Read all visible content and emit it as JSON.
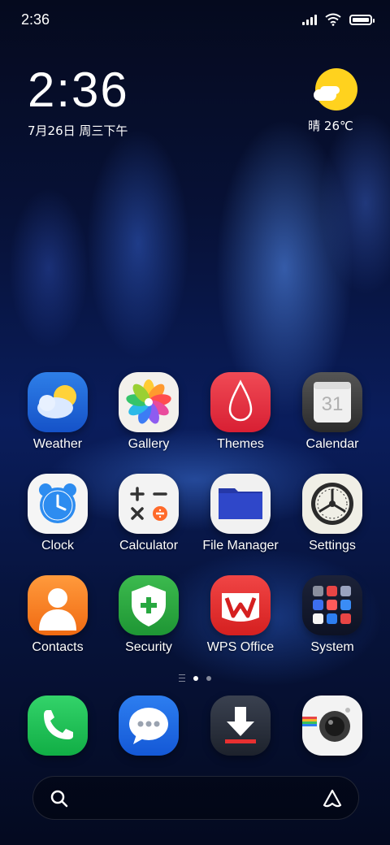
{
  "status_bar": {
    "time": "2:36",
    "battery_level": 0.9
  },
  "clock_widget": {
    "time": "2:36",
    "date": "7月26日 周三下午"
  },
  "weather_widget": {
    "condition_temp": "晴 26℃",
    "sun_color": "#ffd21e"
  },
  "apps": [
    {
      "label": "Weather",
      "icon": "weather-icon"
    },
    {
      "label": "Gallery",
      "icon": "gallery-flower-icon"
    },
    {
      "label": "Themes",
      "icon": "themes-drop-icon"
    },
    {
      "label": "Calendar",
      "icon": "calendar-icon",
      "badge": "31"
    },
    {
      "label": "Clock",
      "icon": "clock-icon"
    },
    {
      "label": "Calculator",
      "icon": "calculator-icon"
    },
    {
      "label": "File Manager",
      "icon": "folder-icon"
    },
    {
      "label": "Settings",
      "icon": "gear-icon"
    },
    {
      "label": "Contacts",
      "icon": "contact-person-icon"
    },
    {
      "label": "Security",
      "icon": "shield-icon"
    },
    {
      "label": "WPS Office",
      "icon": "wps-icon"
    },
    {
      "label": "System",
      "icon": "folder-system-icon"
    }
  ],
  "dock": [
    {
      "name": "phone",
      "icon": "phone-icon"
    },
    {
      "name": "messages",
      "icon": "message-bubble-icon"
    },
    {
      "name": "downloads",
      "icon": "download-icon"
    },
    {
      "name": "camera",
      "icon": "camera-icon"
    }
  ],
  "page_indicator": {
    "pages": 2,
    "current": 1
  },
  "search": {
    "icon": "search-icon",
    "assistant_icon": "assistant-icon"
  }
}
